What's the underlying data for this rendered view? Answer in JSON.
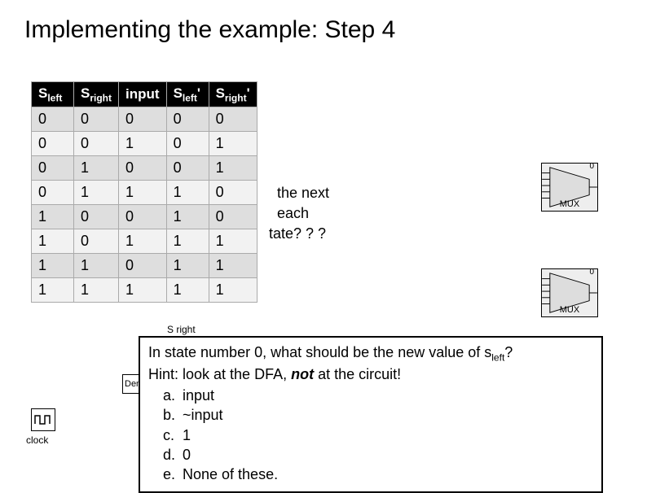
{
  "title": "Implementing the example: Step 4",
  "table": {
    "headers": {
      "c0": {
        "base": "S",
        "sub": "left"
      },
      "c1": {
        "base": "S",
        "sub": "right"
      },
      "c2": "input",
      "c3": {
        "base": "S",
        "sub": "left",
        "prime": "'"
      },
      "c4": {
        "base": "S",
        "sub": "right",
        "prime": "'"
      }
    },
    "rows": [
      [
        "0",
        "0",
        "0",
        "0",
        "0"
      ],
      [
        "0",
        "0",
        "1",
        "0",
        "1"
      ],
      [
        "0",
        "1",
        "0",
        "0",
        "1"
      ],
      [
        "0",
        "1",
        "1",
        "1",
        "0"
      ],
      [
        "1",
        "0",
        "0",
        "1",
        "0"
      ],
      [
        "1",
        "0",
        "1",
        "1",
        "1"
      ],
      [
        "1",
        "1",
        "0",
        "1",
        "1"
      ],
      [
        "1",
        "1",
        "1",
        "1",
        "1"
      ]
    ]
  },
  "bg_question": {
    "l1": "the next",
    "l2": "each",
    "l3": "tate? ? ?"
  },
  "mux": {
    "label": "MUX",
    "zero": "0"
  },
  "clock": {
    "label": "clock"
  },
  "den": {
    "label": "Den"
  },
  "sright_small": "S right",
  "qa": {
    "line1_pre": "In state number 0, what should be the new value of s",
    "line1_sub": "left",
    "line1_post": "?",
    "line2_pre": "Hint: look at the DFA, ",
    "line2_bold": "not",
    "line2_post": " at the circuit!",
    "options": {
      "a": {
        "letter": "a.",
        "text": "input"
      },
      "b": {
        "letter": "b.",
        "text": "~input"
      },
      "c": {
        "letter": "c.",
        "text": "1"
      },
      "d": {
        "letter": "d.",
        "text": "0"
      },
      "e": {
        "letter": "e.",
        "text": "None of these."
      }
    }
  }
}
